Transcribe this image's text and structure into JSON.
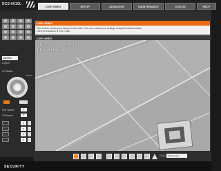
{
  "header": {
    "model": "DCS-6010L"
  },
  "tabs": [
    {
      "label": "LIVE VIDEO"
    },
    {
      "label": "SETUP"
    },
    {
      "label": "ADVANCED"
    },
    {
      "label": "MAINTENANCE"
    },
    {
      "label": "STATUS"
    },
    {
      "label": "HELP"
    }
  ],
  "left_panel": {
    "user_select": "Camera",
    "logout": "Logout",
    "io_status": "I/O Status",
    "home": "Home",
    "pan_speed_label": "Pan Speed",
    "pan_speed_value": "0",
    "tilt_speed_label": "Tilt Speed",
    "tilt_speed_value": "0",
    "controls": [
      {
        "value": "0"
      },
      {
        "value": "0"
      },
      {
        "value": "0"
      },
      {
        "value": "0"
      }
    ],
    "language_label": "Select language",
    "language_value": "English"
  },
  "main": {
    "section_title": "LIVE VIDEO",
    "description": "The section shows your camera's live video. You can control your settings using the buttons below.",
    "resolution": "Current resolution is 720 x 480.",
    "video_title": "LIVE VIDEO",
    "overlay_line1": "2012/10/10 15:11:31",
    "overlay_line2": "DCS-6010L"
  },
  "toolbar": {
    "go_label": "GoTo",
    "preset_value": "--Preset List--"
  },
  "footer": {
    "brand": "SECURITY"
  },
  "colors": {
    "accent": "#ec6a13"
  }
}
